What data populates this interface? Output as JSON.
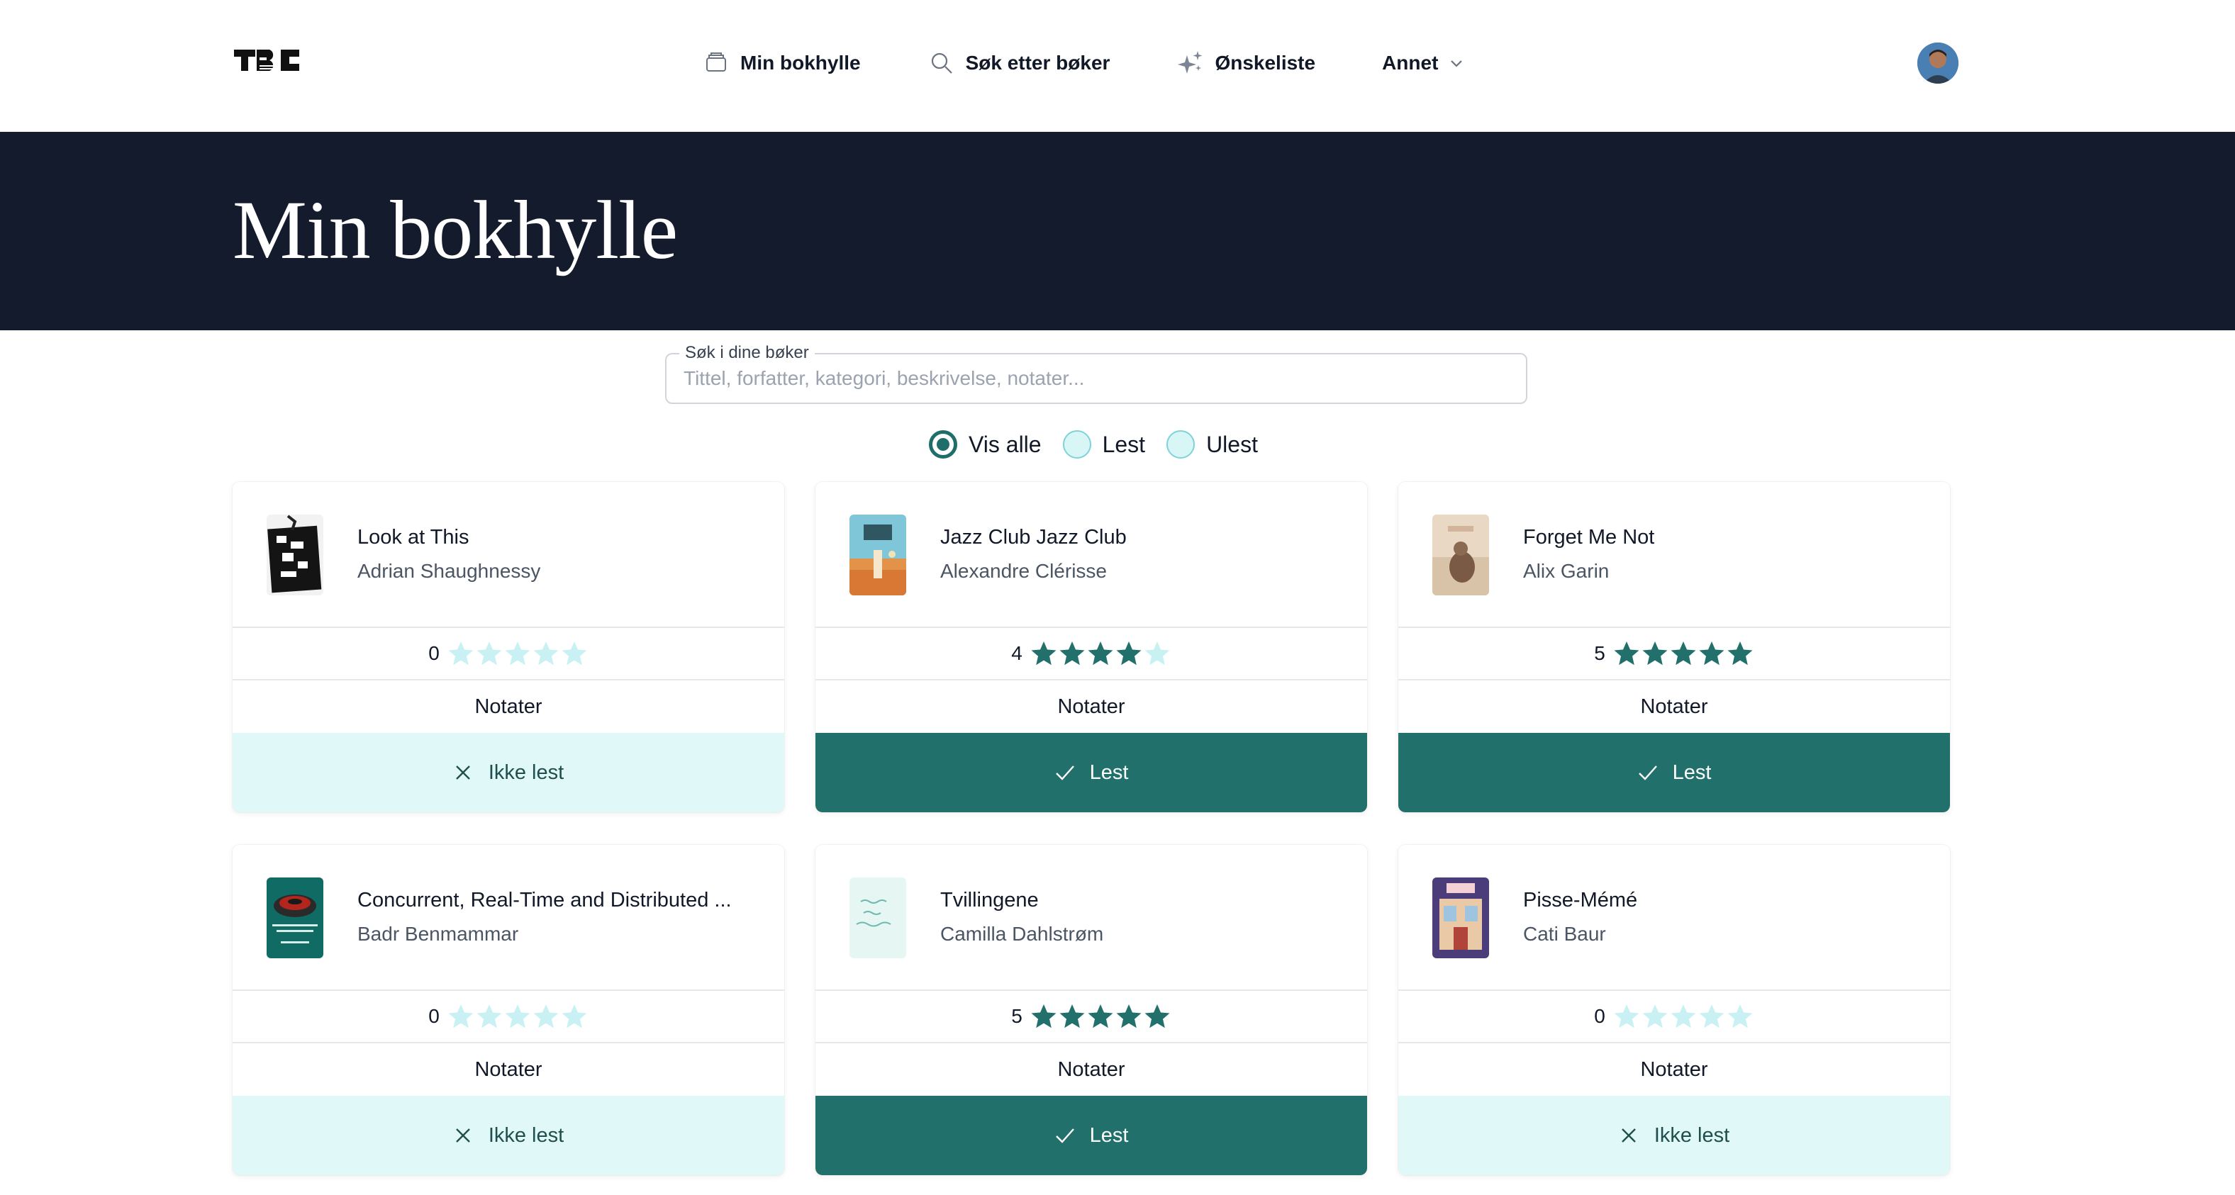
{
  "nav": {
    "logo_text": "TBC",
    "links": [
      {
        "label": "Min bokhylle",
        "icon": "shelf-icon"
      },
      {
        "label": "Søk etter bøker",
        "icon": "search-icon"
      },
      {
        "label": "Ønskeliste",
        "icon": "sparkle-icon"
      },
      {
        "label": "Annet",
        "icon": "chevron-down-icon"
      }
    ],
    "avatar": "user-avatar"
  },
  "hero": {
    "title": "Min bokhylle"
  },
  "search": {
    "label": "Søk i dine bøker",
    "placeholder": "Tittel, forfatter, kategori, beskrivelse, notater...",
    "value": ""
  },
  "filter": {
    "options": [
      "Vis alle",
      "Lest",
      "Ulest"
    ],
    "selected": "Vis alle"
  },
  "colors": {
    "primary": "#22706b",
    "star_filled": "#22706b",
    "star_empty": "#c9f1f3",
    "unread_bg": "#e0f8f8",
    "hero_bg": "#141b2d"
  },
  "books": [
    {
      "title": "Look at This",
      "author": "Adrian Shaughnessy",
      "rating": 0,
      "rating_label": "0",
      "notes_label": "Notater",
      "status_label": "Ikke lest",
      "read": false
    },
    {
      "title": "Jazz Club Jazz Club",
      "author": "Alexandre Clérisse",
      "rating": 4,
      "rating_label": "4",
      "notes_label": "Notater",
      "status_label": "Lest",
      "read": true
    },
    {
      "title": "Forget Me Not",
      "author": "Alix Garin",
      "rating": 5,
      "rating_label": "5",
      "notes_label": "Notater",
      "status_label": "Lest",
      "read": true
    },
    {
      "title": "Concurrent, Real-Time and Distributed ...",
      "author": "Badr Benmammar",
      "rating": 0,
      "rating_label": "0",
      "notes_label": "Notater",
      "status_label": "Ikke lest",
      "read": false
    },
    {
      "title": "Tvillingene",
      "author": "Camilla Dahlstrøm",
      "rating": 5,
      "rating_label": "5",
      "notes_label": "Notater",
      "status_label": "Lest",
      "read": true
    },
    {
      "title": "Pisse-Mémé",
      "author": "Cati Baur",
      "rating": 0,
      "rating_label": "0",
      "notes_label": "Notater",
      "status_label": "Ikke lest",
      "read": false
    }
  ]
}
